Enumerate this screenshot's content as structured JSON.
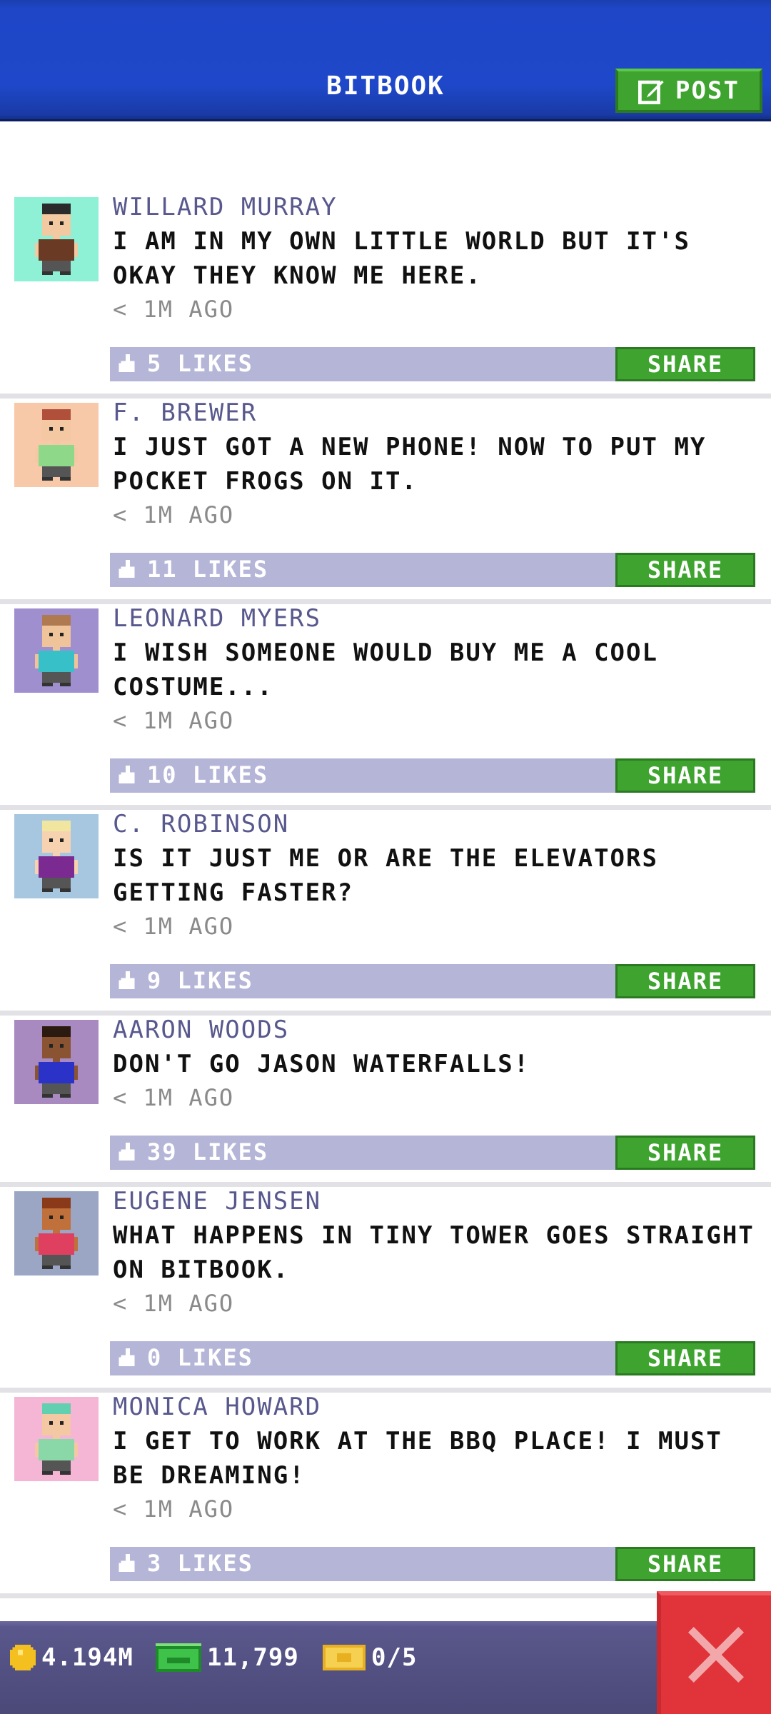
{
  "header": {
    "title": "BITBOOK",
    "post_label": "POST"
  },
  "posts": [
    {
      "name": "WILLARD MURRAY",
      "message": "I AM IN MY OWN LITTLE WORLD BUT IT'S OKAY THEY KNOW ME HERE.",
      "time": "< 1M AGO",
      "likes": "5 LIKES",
      "share": "SHARE",
      "avatar_bg": "#8ef0d4",
      "skin": "#f2c9a0",
      "shirt": "#6b3a24",
      "hair": "#2a2a2a"
    },
    {
      "name": "F. BREWER",
      "message": "I JUST GOT A NEW PHONE! NOW TO PUT MY POCKET FROGS ON IT.",
      "time": "< 1M AGO",
      "likes": "11 LIKES",
      "share": "SHARE",
      "avatar_bg": "#f8c9a8",
      "skin": "#f4c8a2",
      "shirt": "#8ed88a",
      "hair": "#b0503a"
    },
    {
      "name": "LEONARD MYERS",
      "message": "I WISH SOMEONE WOULD BUY ME A COOL COSTUME...",
      "time": "< 1M AGO",
      "likes": "10 LIKES",
      "share": "SHARE",
      "avatar_bg": "#9f8fcf",
      "skin": "#f0c49a",
      "shirt": "#38c0c8",
      "hair": "#b07a50"
    },
    {
      "name": "C. ROBINSON",
      "message": "IS IT JUST ME OR ARE THE ELEVATORS GETTING FASTER?",
      "time": "< 1M AGO",
      "likes": "9 LIKES",
      "share": "SHARE",
      "avatar_bg": "#a7c6e0",
      "skin": "#f6d2b0",
      "shirt": "#7a2a90",
      "hair": "#f0e6a0"
    },
    {
      "name": "AARON WOODS",
      "message": "DON'T GO JASON WATERFALLS!",
      "time": "< 1M AGO",
      "likes": "39 LIKES",
      "share": "SHARE",
      "avatar_bg": "#a88ac0",
      "skin": "#8a5432",
      "shirt": "#2a32c8",
      "hair": "#2a1a10"
    },
    {
      "name": "EUGENE JENSEN",
      "message": "WHAT HAPPENS IN TINY TOWER GOES STRAIGHT ON BITBOOK.",
      "time": "< 1M AGO",
      "likes": "0 LIKES",
      "share": "SHARE",
      "avatar_bg": "#9aa6c4",
      "skin": "#c0703a",
      "shirt": "#e04060",
      "hair": "#8a3a18"
    },
    {
      "name": "MONICA HOWARD",
      "message": "I GET TO WORK AT THE BBQ PLACE! I MUST BE DREAMING!",
      "time": "< 1M AGO",
      "likes": "3 LIKES",
      "share": "SHARE",
      "avatar_bg": "#f4b6d4",
      "skin": "#f4c8a2",
      "shirt": "#8ad8a8",
      "hair": "#60d0b0"
    }
  ],
  "bottom_bar": {
    "coins": "4.194M",
    "bux": "11,799",
    "tickets": "0/5"
  },
  "colors": {
    "header_blue": "#1e46c7",
    "accent_green": "#3ea42f",
    "like_bar": "#b5b5d8",
    "name_color": "#58588e",
    "close_red": "#e0343a"
  },
  "icons": {
    "post": "edit-icon",
    "like": "thumbs-up-icon",
    "coin": "coin-icon",
    "bux": "bux-icon",
    "ticket": "ticket-icon",
    "close": "close-icon"
  }
}
